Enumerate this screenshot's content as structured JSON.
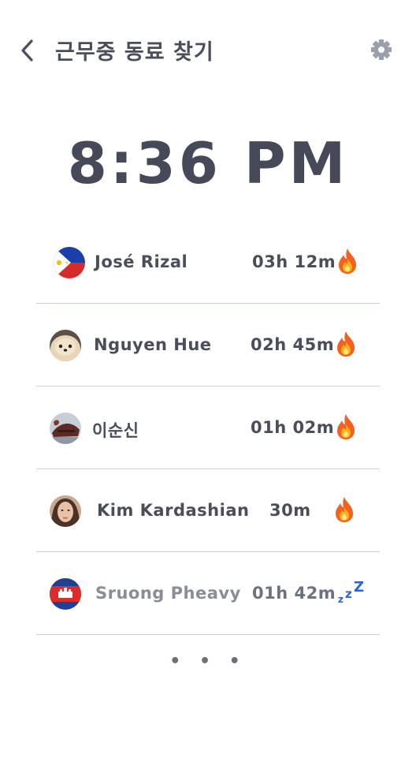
{
  "header": {
    "title": "근무중 동료 찾기",
    "back_icon": "chevron-left-icon",
    "settings_icon": "gear-icon"
  },
  "clock": {
    "time": "8:36 PM"
  },
  "colleagues": [
    {
      "name": "José Rizal",
      "duration": "03h 12m",
      "status": "working",
      "status_icon": "fire-icon",
      "avatar": "philippines-flag"
    },
    {
      "name": "Nguyen Hue",
      "duration": "02h 45m",
      "status": "working",
      "status_icon": "fire-icon",
      "avatar": "pomeranian-dog-photo"
    },
    {
      "name": "이순신",
      "duration": "01h 02m",
      "status": "working",
      "status_icon": "fire-icon",
      "avatar": "turtle-ship-photo"
    },
    {
      "name": "Kim Kardashian",
      "duration": "30m",
      "status": "working",
      "status_icon": "fire-icon",
      "avatar": "portrait-photo"
    },
    {
      "name": "Sruong Pheavy",
      "duration": "01h 42m",
      "status": "sleeping",
      "status_icon": "sleep-zzz-icon",
      "avatar": "cambodia-flag"
    }
  ],
  "more": {
    "label": "• • •"
  },
  "colors": {
    "text": "#4a4e5a",
    "muted": "#8a8d94",
    "divider": "#c9cfe0",
    "fire": "#f5601e",
    "sleep": "#2b63d9"
  }
}
